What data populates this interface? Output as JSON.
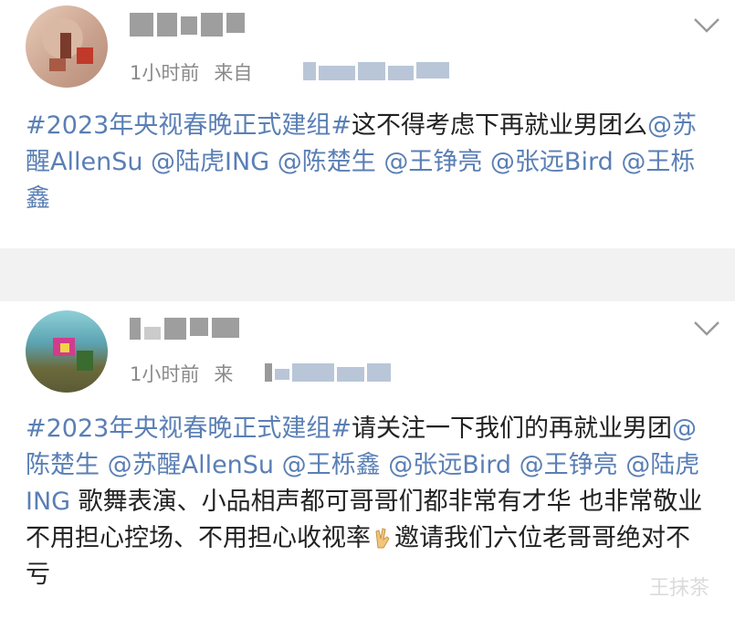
{
  "posts": [
    {
      "time": "1小时前",
      "source_prefix": "来自",
      "body_segments": [
        {
          "type": "tag",
          "text": "#2023年央视春晚正式建组#"
        },
        {
          "type": "text",
          "text": "这不得考虑下再就业男团么"
        },
        {
          "type": "mention",
          "text": "@苏醒AllenSu"
        },
        {
          "type": "text",
          "text": " "
        },
        {
          "type": "mention",
          "text": "@陆虎ING"
        },
        {
          "type": "text",
          "text": " "
        },
        {
          "type": "mention",
          "text": "@陈楚生"
        },
        {
          "type": "text",
          "text": " "
        },
        {
          "type": "mention",
          "text": "@王铮亮"
        },
        {
          "type": "text",
          "text": " "
        },
        {
          "type": "mention",
          "text": "@张远Bird"
        },
        {
          "type": "text",
          "text": " "
        },
        {
          "type": "mention",
          "text": "@王栎鑫"
        }
      ]
    },
    {
      "time": "1小时前",
      "source_prefix": "来",
      "body_segments": [
        {
          "type": "tag",
          "text": "#2023年央视春晚正式建组#"
        },
        {
          "type": "text",
          "text": "请关注一下我们的再就业男团"
        },
        {
          "type": "mention",
          "text": "@陈楚生"
        },
        {
          "type": "text",
          "text": " "
        },
        {
          "type": "mention",
          "text": "@苏醒AllenSu"
        },
        {
          "type": "text",
          "text": " "
        },
        {
          "type": "mention",
          "text": "@王栎鑫"
        },
        {
          "type": "text",
          "text": " "
        },
        {
          "type": "mention",
          "text": "@张远Bird"
        },
        {
          "type": "text",
          "text": " "
        },
        {
          "type": "mention",
          "text": "@王铮亮"
        },
        {
          "type": "text",
          "text": " "
        },
        {
          "type": "mention",
          "text": "@陆虎ING"
        },
        {
          "type": "text",
          "text": " 歌舞表演、小品相声都可哥哥们都非常有才华 也非常敬业 不用担心控场、不用担心收视率"
        },
        {
          "type": "emoji",
          "name": "victory-hand-icon"
        },
        {
          "type": "text",
          "text": "邀请我们六位老哥哥绝对不亏"
        }
      ]
    }
  ],
  "watermark": "王抹茶",
  "colors": {
    "link": "#5a7fb5",
    "meta": "#8a8a8a",
    "divider": "#f2f2f2"
  }
}
